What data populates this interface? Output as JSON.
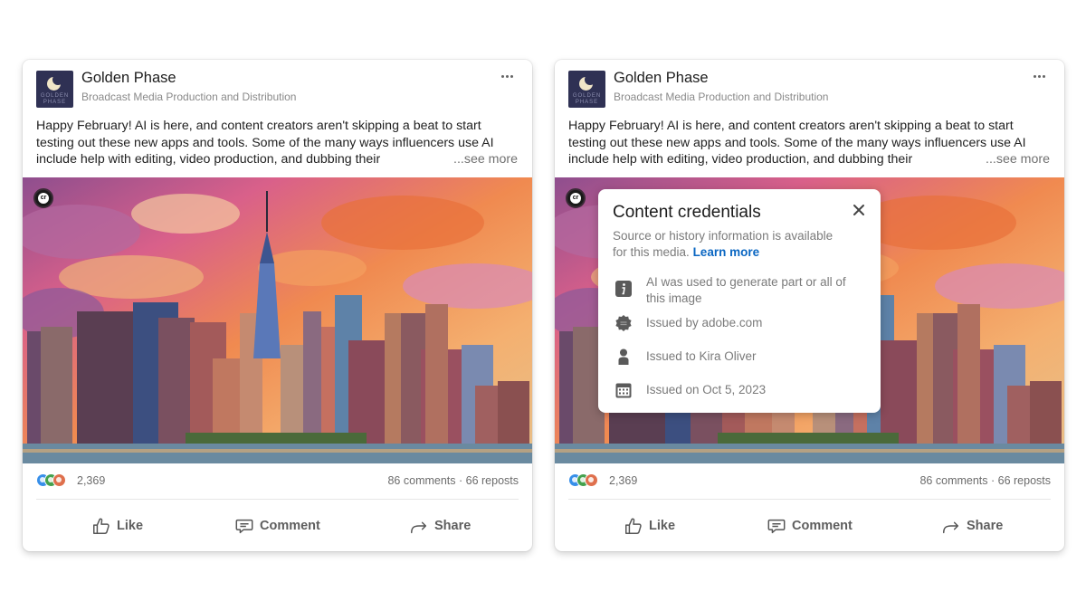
{
  "posts": [
    {
      "company": "Golden Phase",
      "tagline": "Broadcast Media Production and Distribution",
      "logo_text": [
        "GOLDEN",
        "PHASE"
      ],
      "text_lines": [
        "Happy February! AI is here, and content creators aren't skipping a beat to start",
        "testing out these new apps and tools. Some of the many ways influencers use AI",
        "include help with editing, video production, and dubbing their"
      ],
      "see_more": "...see more",
      "media_badge": "cr",
      "reaction_count": "2,369",
      "counts": "86 comments · 66 reposts",
      "actions": {
        "like": "Like",
        "comment": "Comment",
        "share": "Share"
      }
    },
    {
      "company": "Golden Phase",
      "tagline": "Broadcast Media Production and Distribution",
      "logo_text": [
        "GOLDEN",
        "PHASE"
      ],
      "text_lines": [
        "Happy February! AI is here, and content creators aren't skipping a beat to start",
        "testing out these new apps and tools. Some of the many ways influencers use AI",
        "include help with editing, video production, and dubbing their"
      ],
      "see_more": "...see more",
      "media_badge": "cr",
      "reaction_count": "2,369",
      "counts": "86 comments · 66 reposts",
      "actions": {
        "like": "Like",
        "comment": "Comment",
        "share": "Share"
      }
    }
  ],
  "credentials_popup": {
    "title": "Content credentials",
    "description": "Source or history information is available for this media.",
    "learn_more": "Learn more",
    "items": [
      {
        "icon": "info-icon",
        "text": "AI was used to generate part or all of this image"
      },
      {
        "icon": "verified-badge-icon",
        "text": "Issued by adobe.com"
      },
      {
        "icon": "person-icon",
        "text": "Issued to Kira Oliver"
      },
      {
        "icon": "calendar-icon",
        "text": "Issued on Oct 5, 2023"
      }
    ]
  }
}
